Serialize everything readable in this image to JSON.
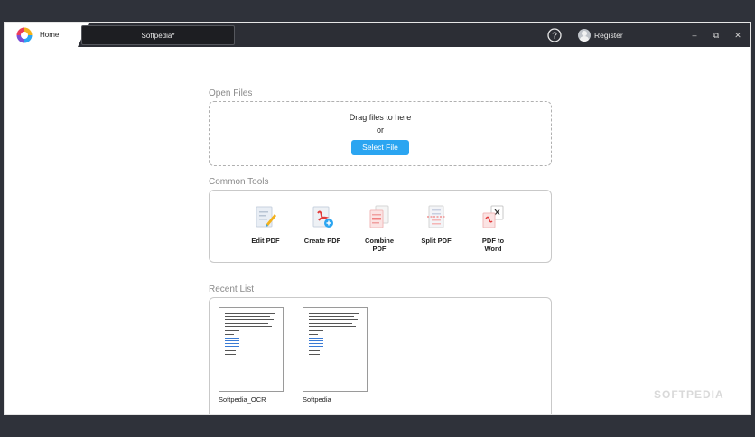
{
  "titlebar": {
    "home_tab": "Home",
    "doc_tab": "Softpedia*",
    "register": "Register",
    "minimize": "–",
    "maximize": "⧉",
    "close": "✕"
  },
  "open_files": {
    "heading": "Open Files",
    "drag_text": "Drag files to here",
    "or_text": "or",
    "select_button": "Select File"
  },
  "common_tools": {
    "heading": "Common Tools",
    "tools": [
      {
        "label_line1": "Edit PDF",
        "label_line2": "",
        "icon": "edit-pdf-icon"
      },
      {
        "label_line1": "Create PDF",
        "label_line2": "",
        "icon": "create-pdf-icon"
      },
      {
        "label_line1": "Combine",
        "label_line2": "PDF",
        "icon": "combine-pdf-icon"
      },
      {
        "label_line1": "Split PDF",
        "label_line2": "",
        "icon": "split-pdf-icon"
      },
      {
        "label_line1": "PDF to",
        "label_line2": "Word",
        "icon": "pdf-to-word-icon"
      }
    ]
  },
  "recent_list": {
    "heading": "Recent List",
    "files": [
      {
        "name": "Softpedia_OCR"
      },
      {
        "name": "Softpedia"
      }
    ]
  },
  "watermark": "SOFTPEDIA",
  "colors": {
    "titlebar": "#2c2e35",
    "accent": "#2ba5f1",
    "background": "#2f323a"
  }
}
